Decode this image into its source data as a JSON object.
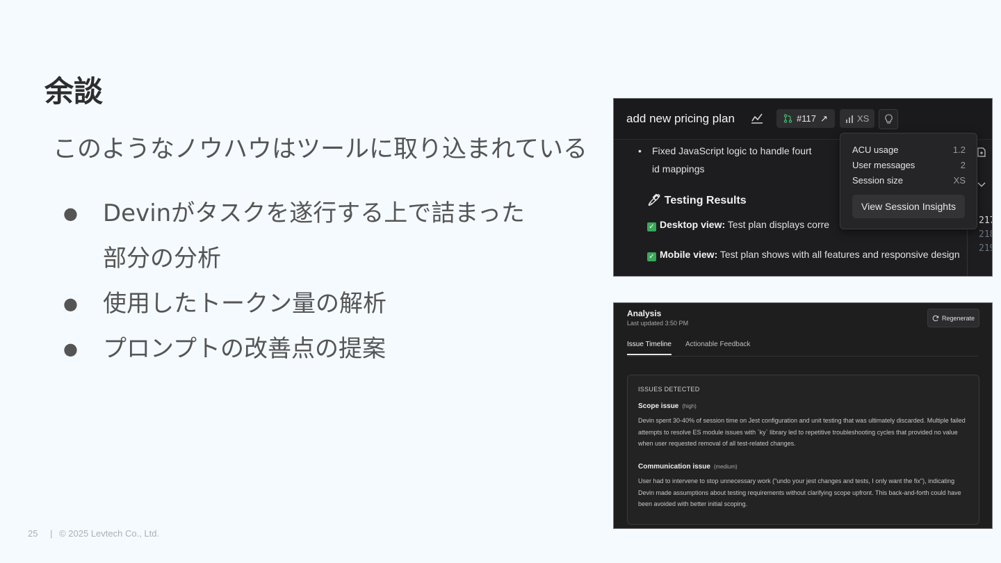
{
  "slide": {
    "title": "余談",
    "subtitle": "このようなノウハウはツールに取り込まれている",
    "bullets": [
      {
        "line1": "Devinがタスクを遂行する上で詰まった",
        "line2": "部分の分析"
      },
      {
        "line1": "使用したトークン量の解析"
      },
      {
        "line1": "プロンプトの改善点の提案"
      }
    ],
    "bullet_symbol": "●",
    "footer": {
      "page": "25",
      "separator": "|",
      "copyright": "© 2025 Levtech Co., Ltd."
    }
  },
  "screenshot1": {
    "session_title": "add new pricing plan",
    "pr_label": "#117",
    "pr_arrow": "↗",
    "size_label": "XS",
    "body": {
      "fix_item_line1": "Fixed JavaScript logic to handle fourt",
      "fix_item_line2": "id mappings",
      "testing_heading": "🖊 Testing Results",
      "results": [
        {
          "label": "Desktop view:",
          "text": " Test plan displays corre"
        },
        {
          "label": "Mobile view:",
          "text": " Test plan shows with all features and responsive design"
        }
      ],
      "line_numbers": [
        "217",
        "218",
        "219"
      ]
    },
    "popover": {
      "rows": [
        {
          "label": "ACU usage",
          "value": "1.2"
        },
        {
          "label": "User messages",
          "value": "2"
        },
        {
          "label": "Session size",
          "value": "XS"
        }
      ],
      "button": "View Session Insights"
    }
  },
  "screenshot2": {
    "title": "Analysis",
    "last_updated": "Last updated 3:50 PM",
    "regenerate_button": "Regenerate",
    "tabs": [
      "Issue Timeline",
      "Actionable Feedback"
    ],
    "issues_heading": "ISSUES DETECTED",
    "issues": [
      {
        "title": "Scope issue",
        "severity": "(high)",
        "description": "Devin spent 30-40% of session time on Jest configuration and unit testing that was ultimately discarded. Multiple failed attempts to resolve ES module issues with `ky` library led to repetitive troubleshooting cycles that provided no value when user requested removal of all test-related changes."
      },
      {
        "title": "Communication issue",
        "severity": "(medium)",
        "description": "User had to intervene to stop unnecessary work (\"undo your jest changes and tests, I only want the fix\"), indicating Devin made assumptions about testing requirements without clarifying scope upfront. This back-and-forth could have been avoided with better initial scoping."
      }
    ]
  },
  "colors": {
    "background": "#f5faff",
    "text": "#555555",
    "dark_panel": "#1d1d1f",
    "git_green": "#3fbf6a",
    "check_green": "#3aa85a"
  }
}
